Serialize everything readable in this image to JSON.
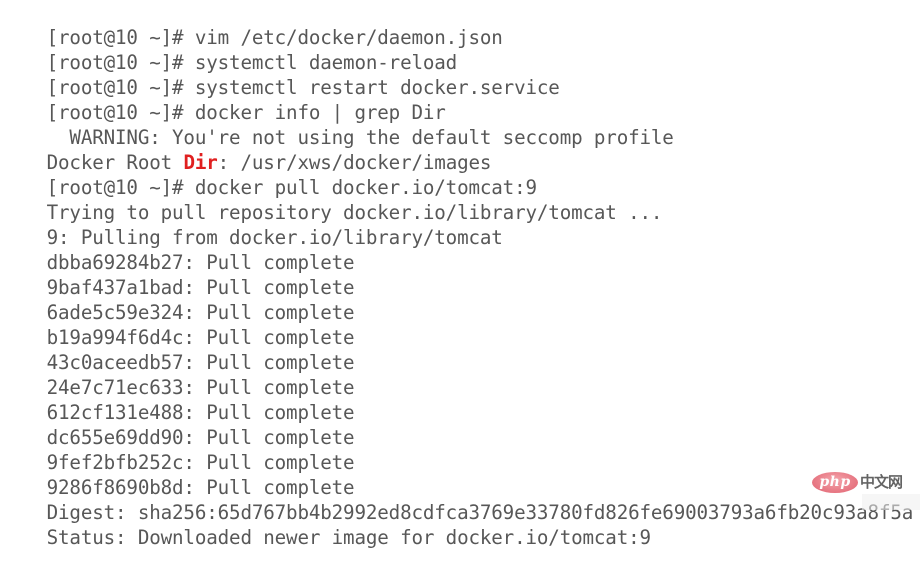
{
  "terminal": {
    "background_color": "#ffffff",
    "text_color": "#575757",
    "highlight_color": "#e02020",
    "prompt": "[root@10 ~]#",
    "lines": [
      {
        "id": "line-1",
        "type": "command",
        "text": "[root@10 ~]# vim /etc/docker/daemon.json"
      },
      {
        "id": "line-2",
        "type": "command",
        "text": "[root@10 ~]# systemctl daemon-reload"
      },
      {
        "id": "line-3",
        "type": "command",
        "text": "[root@10 ~]# systemctl restart docker.service"
      },
      {
        "id": "line-4",
        "type": "command",
        "text": "[root@10 ~]# docker info | grep Dir"
      },
      {
        "id": "line-5",
        "type": "output",
        "text": "  WARNING: You're not using the default seccomp profile"
      },
      {
        "id": "line-6",
        "type": "output-highlight",
        "pre": "Docker Root ",
        "match": "Dir",
        "post": ": /usr/xws/docker/images"
      },
      {
        "id": "line-7",
        "type": "command",
        "text": "[root@10 ~]# docker pull docker.io/tomcat:9"
      },
      {
        "id": "line-8",
        "type": "output",
        "text": "Trying to pull repository docker.io/library/tomcat ..."
      },
      {
        "id": "line-9",
        "type": "output",
        "text": "9: Pulling from docker.io/library/tomcat"
      },
      {
        "id": "line-10",
        "type": "output",
        "text": "dbba69284b27: Pull complete"
      },
      {
        "id": "line-11",
        "type": "output",
        "text": "9baf437a1bad: Pull complete"
      },
      {
        "id": "line-12",
        "type": "output",
        "text": "6ade5c59e324: Pull complete"
      },
      {
        "id": "line-13",
        "type": "output",
        "text": "b19a994f6d4c: Pull complete"
      },
      {
        "id": "line-14",
        "type": "output",
        "text": "43c0aceedb57: Pull complete"
      },
      {
        "id": "line-15",
        "type": "output",
        "text": "24e7c71ec633: Pull complete"
      },
      {
        "id": "line-16",
        "type": "output",
        "text": "612cf131e488: Pull complete"
      },
      {
        "id": "line-17",
        "type": "output",
        "text": "dc655e69dd90: Pull complete"
      },
      {
        "id": "line-18",
        "type": "output",
        "text": "9fef2bfb252c: Pull complete"
      },
      {
        "id": "line-19",
        "type": "output",
        "text": "9286f8690b8d: Pull complete"
      },
      {
        "id": "line-20",
        "type": "output",
        "text": "Digest: sha256:65d767bb4b2992ed8cdfca3769e33780fd826fe69003793a6fb20c93a8f5a"
      },
      {
        "id": "line-21",
        "type": "output",
        "text": "Status: Downloaded newer image for docker.io/tomcat:9"
      }
    ]
  },
  "watermark": {
    "badge_text": "php",
    "site_text": "中文网",
    "badge_color": "#dd5565",
    "site_color": "#4a4a4a"
  }
}
